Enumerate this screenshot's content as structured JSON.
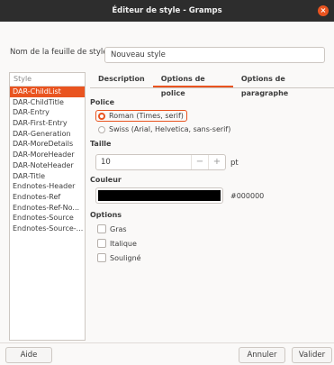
{
  "window": {
    "title": "Éditeur de style - Gramps",
    "close_glyph": "×"
  },
  "sheet": {
    "label": "Nom de la feuille de style :",
    "value": "Nouveau style"
  },
  "style_list": {
    "header": "Style",
    "items": [
      "DAR-ChildList",
      "DAR-ChildTitle",
      "DAR-Entry",
      "DAR-First-Entry",
      "DAR-Generation",
      "DAR-MoreDetails",
      "DAR-MoreHeader",
      "DAR-NoteHeader",
      "DAR-Title",
      "Endnotes-Header",
      "Endnotes-Ref",
      "Endnotes-Ref-No...",
      "Endnotes-Source",
      "Endnotes-Source-..."
    ],
    "selected_index": 0
  },
  "tabs": [
    {
      "label": "Description",
      "active": false
    },
    {
      "label": "Options de police",
      "active": true
    },
    {
      "label": "Options de paragraphe",
      "active": false
    }
  ],
  "font": {
    "section": "Police",
    "options": [
      {
        "label": "Roman (Times, serif)",
        "checked": true
      },
      {
        "label": "Swiss (Arial, Helvetica, sans-serif)",
        "checked": false
      }
    ]
  },
  "size": {
    "section": "Taille",
    "value": "10",
    "minus": "−",
    "plus": "+",
    "unit": "pt"
  },
  "color": {
    "section": "Couleur",
    "hex": "#000000"
  },
  "options": {
    "section": "Options",
    "items": [
      {
        "label": "Gras",
        "checked": false
      },
      {
        "label": "Italique",
        "checked": false
      },
      {
        "label": "Souligné",
        "checked": false
      }
    ]
  },
  "buttons": {
    "help": "Aide",
    "cancel": "Annuler",
    "ok": "Valider"
  },
  "colors": {
    "accent": "#e95420",
    "titlebar": "#2d2d2d"
  }
}
